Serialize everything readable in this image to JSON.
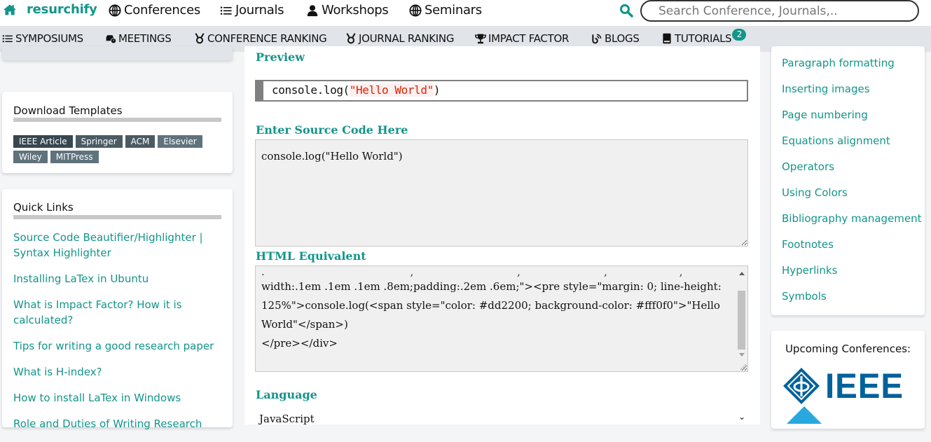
{
  "brand": {
    "name": "resurchify",
    "icon": "home-icon"
  },
  "top_nav": [
    {
      "label": "Conferences",
      "icon": "globe-icon"
    },
    {
      "label": "Journals",
      "icon": "list-icon"
    },
    {
      "label": "Workshops",
      "icon": "user-icon"
    },
    {
      "label": "Seminars",
      "icon": "globe-icon"
    }
  ],
  "search": {
    "placeholder": "Search Conference, Journals,..",
    "value": "",
    "icon": "search-icon"
  },
  "sub_nav": [
    {
      "label": "SYMPOSIUMS",
      "icon": "list-icon"
    },
    {
      "label": "MEETINGS",
      "icon": "car-clock-icon"
    },
    {
      "label": "CONFERENCE RANKING",
      "icon": "medal-icon"
    },
    {
      "label": "JOURNAL RANKING",
      "icon": "medal-icon"
    },
    {
      "label": "IMPACT FACTOR",
      "icon": "trophy-icon"
    },
    {
      "label": "BLOGS",
      "icon": "blog-icon"
    },
    {
      "label": "TUTORIALS",
      "icon": "book-icon",
      "badge": "2"
    }
  ],
  "left_sidebar": {
    "templates": {
      "title": "Download Templates",
      "tags": [
        "IEEE Article",
        "Springer",
        "ACM",
        "Elsevier",
        "Wiley",
        "MITPress"
      ]
    },
    "quick_links": {
      "title": "Quick Links",
      "items": [
        "Source Code Beautifier/Highlighter | Syntax Highlighter",
        "Installing LaTex in Ubuntu",
        "What is Impact Factor? How it is calculated?",
        "Tips for writing a good research paper",
        "What is H-index?",
        "How to install LaTex in Windows",
        "Role and Duties of Writing Research"
      ]
    }
  },
  "main": {
    "preview_label": "Preview",
    "preview": {
      "prefix": "console.log(",
      "string": "\"Hello World\"",
      "suffix": ")"
    },
    "source_label": "Enter Source Code Here",
    "source_value": "console.log(\"Hello World\")",
    "html_label": "HTML Equivalent",
    "html_lines": [
      "width:.1em .1em .1em .8em;padding:.2em .6em;\"><pre style=\"margin: 0; line-height:",
      "125%\">console.log(<span style=\"color: #dd2200; background-color: #fff0f0\">\"Hello",
      "World\"</span>)",
      "</pre></div>"
    ],
    "language_label": "Language",
    "language_value": "JavaScript"
  },
  "right_sidebar": {
    "links": [
      "Paragraph formatting",
      "Inserting images",
      "Page numbering",
      "Equations alignment",
      "Operators",
      "Using Colors",
      "Bibliography management",
      "Footnotes",
      "Hyperlinks",
      "Symbols"
    ],
    "upcoming_title": "Upcoming Conferences:",
    "logo_text": "IEEE"
  },
  "colors": {
    "accent": "#13958a",
    "string": "#dd2200",
    "string_bg": "#fff0f0",
    "ieee_blue": "#00629b"
  }
}
